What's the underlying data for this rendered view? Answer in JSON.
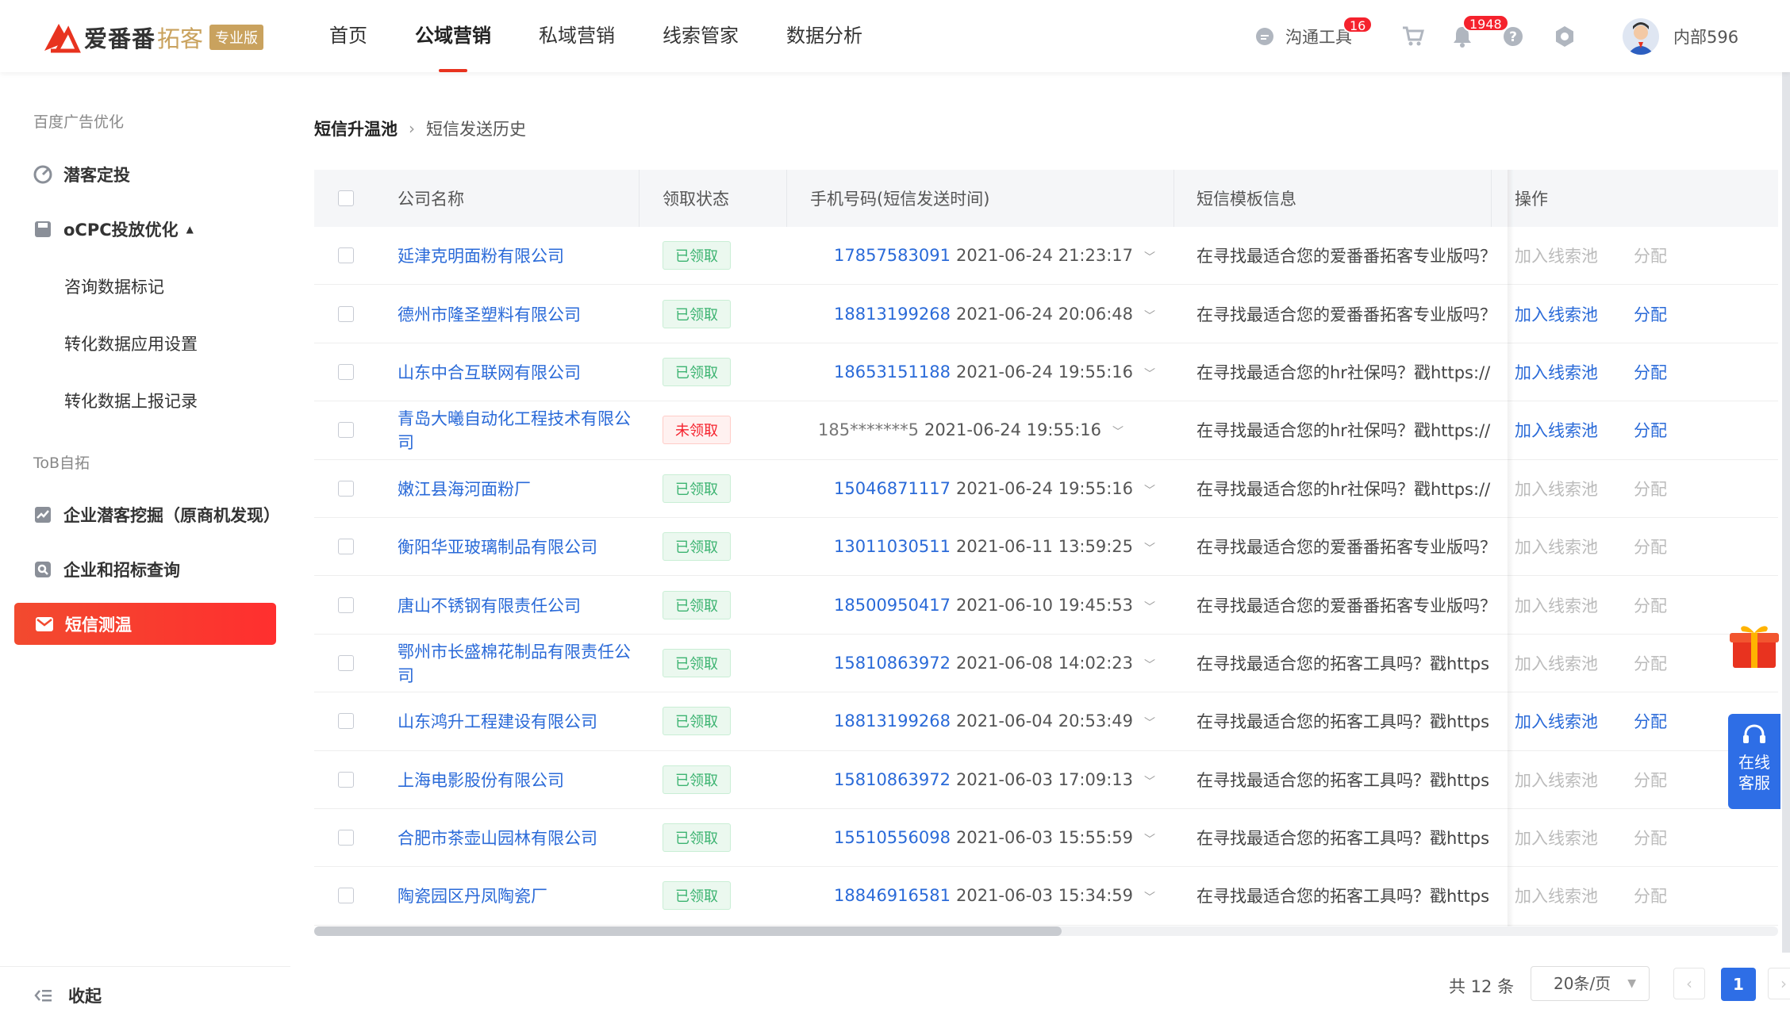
{
  "brand": {
    "name": "爱番番",
    "sub": "拓客",
    "badge": "专业版",
    "accent": "#e8331f"
  },
  "nav": [
    {
      "label": "首页"
    },
    {
      "label": "公域营销",
      "active": true
    },
    {
      "label": "私域营销"
    },
    {
      "label": "线索管家"
    },
    {
      "label": "数据分析"
    }
  ],
  "topbar": {
    "comm_tool_label": "沟通工具",
    "comm_badge": "16",
    "cart_icon": "cart-icon",
    "notice_badge": "1948",
    "user_name": "内部596"
  },
  "sidebar": {
    "group1": "百度广告优化",
    "item_qianke": "潜客定投",
    "item_ocpc": "oCPC投放优化",
    "sub1": "咨询数据标记",
    "sub2": "转化数据应用设置",
    "sub3": "转化数据上报记录",
    "group2": "ToB自拓",
    "item_mining": "企业潜客挖掘（原商机发现）",
    "item_bid": "企业和招标查询",
    "item_sms": "短信测温",
    "collapse": "收起"
  },
  "breadcrumb": {
    "first": "短信升温池",
    "second": "短信发送历史"
  },
  "table": {
    "headers": {
      "company": "公司名称",
      "status": "领取状态",
      "phone": "手机号码(短信发送时间)",
      "template": "短信模板信息",
      "op": "操作"
    },
    "rows": [
      {
        "company": "延津克明面粉有限公司",
        "status": "已领取",
        "phone": "17857583091",
        "time": "2021-06-24 21:23:17",
        "template": "在寻找最适合您的爱番番拓客专业版吗？",
        "add": "加入线索池",
        "assign": "分配",
        "enabled": false
      },
      {
        "company": "德州市隆圣塑料有限公司",
        "status": "已领取",
        "phone": "18813199268",
        "time": "2021-06-24 20:06:48",
        "template": "在寻找最适合您的爱番番拓客专业版吗？",
        "add": "加入线索池",
        "assign": "分配",
        "enabled": true
      },
      {
        "company": "山东中合互联网有限公司",
        "status": "已领取",
        "phone": "18653151188",
        "time": "2021-06-24 19:55:16",
        "template": "在寻找最适合您的hr社保吗？戳https://",
        "add": "加入线索池",
        "assign": "分配",
        "enabled": true
      },
      {
        "company": "青岛大曦自动化工程技术有限公司",
        "status": "未领取",
        "phone": "185*******5",
        "time": "2021-06-24 19:55:16",
        "template": "在寻找最适合您的hr社保吗？戳https://",
        "add": "加入线索池",
        "assign": "分配",
        "enabled": true,
        "masked": true
      },
      {
        "company": "嫩江县海河面粉厂",
        "status": "已领取",
        "phone": "15046871117",
        "time": "2021-06-24 19:55:16",
        "template": "在寻找最适合您的hr社保吗？戳https://",
        "add": "加入线索池",
        "assign": "分配",
        "enabled": false
      },
      {
        "company": "衡阳华亚玻璃制品有限公司",
        "status": "已领取",
        "phone": "13011030511",
        "time": "2021-06-11 13:59:25",
        "template": "在寻找最适合您的爱番番拓客专业版吗？",
        "add": "加入线索池",
        "assign": "分配",
        "enabled": false
      },
      {
        "company": "唐山不锈钢有限责任公司",
        "status": "已领取",
        "phone": "18500950417",
        "time": "2021-06-10 19:45:53",
        "template": "在寻找最适合您的爱番番拓客专业版吗？",
        "add": "加入线索池",
        "assign": "分配",
        "enabled": false
      },
      {
        "company": "鄂州市长盛棉花制品有限责任公司",
        "status": "已领取",
        "phone": "15810863972",
        "time": "2021-06-08 14:02:23",
        "template": "在寻找最适合您的拓客工具吗？戳https",
        "add": "加入线索池",
        "assign": "分配",
        "enabled": false
      },
      {
        "company": "山东鸿升工程建设有限公司",
        "status": "已领取",
        "phone": "18813199268",
        "time": "2021-06-04 20:53:49",
        "template": "在寻找最适合您的拓客工具吗？戳https",
        "add": "加入线索池",
        "assign": "分配",
        "enabled": true
      },
      {
        "company": "上海电影股份有限公司",
        "status": "已领取",
        "phone": "15810863972",
        "time": "2021-06-03 17:09:13",
        "template": "在寻找最适合您的拓客工具吗？戳https",
        "add": "加入线索池",
        "assign": "分配",
        "enabled": false
      },
      {
        "company": "合肥市茶壶山园林有限公司",
        "status": "已领取",
        "phone": "15510556098",
        "time": "2021-06-03 15:55:59",
        "template": "在寻找最适合您的拓客工具吗？戳https",
        "add": "加入线索池",
        "assign": "分配",
        "enabled": false
      },
      {
        "company": "陶瓷园区丹凤陶瓷厂",
        "status": "已领取",
        "phone": "18846916581",
        "time": "2021-06-03 15:34:59",
        "template": "在寻找最适合您的拓客工具吗？戳https",
        "add": "加入线索池",
        "assign": "分配",
        "enabled": false
      }
    ]
  },
  "pager": {
    "total": "共 12 条",
    "page_size": "20条/页",
    "current": "1"
  },
  "service": {
    "line1": "在线",
    "line2": "客服"
  }
}
